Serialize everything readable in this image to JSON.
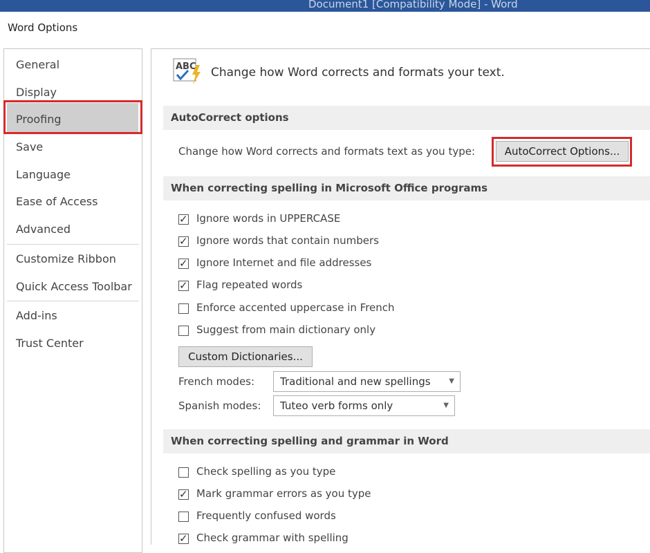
{
  "window": {
    "title": "Document1 [Compatibility Mode]  -  Word"
  },
  "dialog": {
    "title": "Word Options"
  },
  "sidebar": {
    "items": [
      {
        "label": "General"
      },
      {
        "label": "Display"
      },
      {
        "label": "Proofing",
        "selected": true
      },
      {
        "label": "Save"
      },
      {
        "label": "Language"
      },
      {
        "label": "Ease of Access"
      },
      {
        "label": "Advanced"
      },
      {
        "label": "Customize Ribbon"
      },
      {
        "label": "Quick Access Toolbar"
      },
      {
        "label": "Add-ins"
      },
      {
        "label": "Trust Center"
      }
    ]
  },
  "header": {
    "text": "Change how Word corrects and formats your text.",
    "icon_text": "ABC",
    "icon": "abc-check-icon"
  },
  "autocorrect": {
    "heading": "AutoCorrect options",
    "description": "Change how Word corrects and formats text as you type:",
    "button_label": "AutoCorrect Options..."
  },
  "office_spelling": {
    "heading": "When correcting spelling in Microsoft Office programs",
    "options": [
      {
        "label": "Ignore words in UPPERCASE",
        "checked": true
      },
      {
        "label": "Ignore words that contain numbers",
        "checked": true
      },
      {
        "label": "Ignore Internet and file addresses",
        "checked": true
      },
      {
        "label": "Flag repeated words",
        "checked": true
      },
      {
        "label": "Enforce accented uppercase in French",
        "checked": false
      },
      {
        "label": "Suggest from main dictionary only",
        "checked": false
      }
    ],
    "custom_dict_label": "Custom Dictionaries...",
    "french_label": "French modes:",
    "french_value": "Traditional and new spellings",
    "spanish_label": "Spanish modes:",
    "spanish_value": "Tuteo verb forms only"
  },
  "word_spelling": {
    "heading": "When correcting spelling and grammar in Word",
    "options": [
      {
        "label": "Check spelling as you type",
        "checked": false
      },
      {
        "label": "Mark grammar errors as you type",
        "checked": true
      },
      {
        "label": "Frequently confused words",
        "checked": false
      },
      {
        "label": "Check grammar with spelling",
        "checked": true
      }
    ]
  },
  "colors": {
    "title_bar": "#2b579a",
    "highlight": "#d42a2a",
    "selected_bg": "#cfcfcf"
  }
}
